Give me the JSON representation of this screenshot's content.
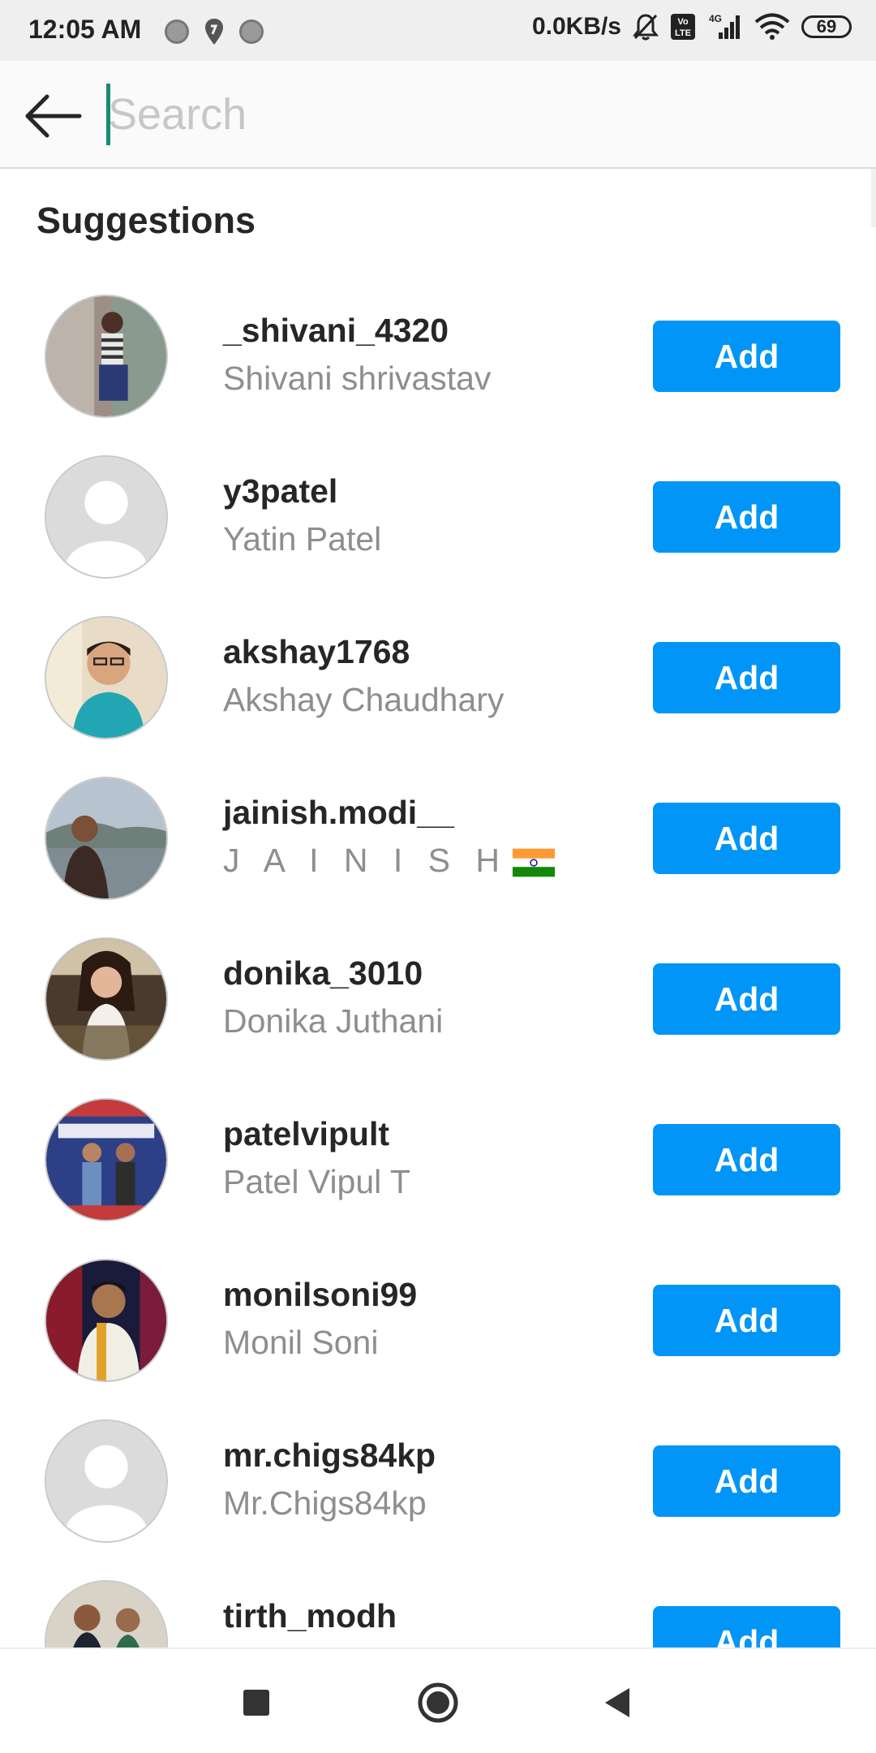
{
  "status_bar": {
    "time": "12:05 AM",
    "network_speed": "0.0KB/s",
    "battery": "69",
    "network_label": "4G",
    "volte_label": "Vo LTE"
  },
  "search": {
    "placeholder": "Search",
    "value": ""
  },
  "section_title": "Suggestions",
  "add_label": "Add",
  "suggestions": [
    {
      "username": "_shivani_4320",
      "full_name": "Shivani shrivastav",
      "avatar": "photo"
    },
    {
      "username": "y3patel",
      "full_name": "Yatin Patel",
      "avatar": "default"
    },
    {
      "username": "akshay1768",
      "full_name": "Akshay Chaudhary",
      "avatar": "photo"
    },
    {
      "username": "jainish.modi__",
      "full_name": "J A I N I S H",
      "full_name_suffix": "india-flag-emoji",
      "avatar": "photo"
    },
    {
      "username": "donika_3010",
      "full_name": "Donika Juthani",
      "avatar": "photo"
    },
    {
      "username": "patelvipult",
      "full_name": "Patel Vipul T",
      "avatar": "photo"
    },
    {
      "username": "monilsoni99",
      "full_name": "Monil Soni",
      "avatar": "photo"
    },
    {
      "username": "mr.chigs84kp",
      "full_name": "Mr.Chigs84kp",
      "avatar": "default"
    },
    {
      "username": "tirth_modh",
      "full_name": "",
      "avatar": "photo"
    }
  ],
  "colors": {
    "accent": "#0095f6",
    "caret": "#1a8a78",
    "secondary_text": "#8e8e8e"
  }
}
